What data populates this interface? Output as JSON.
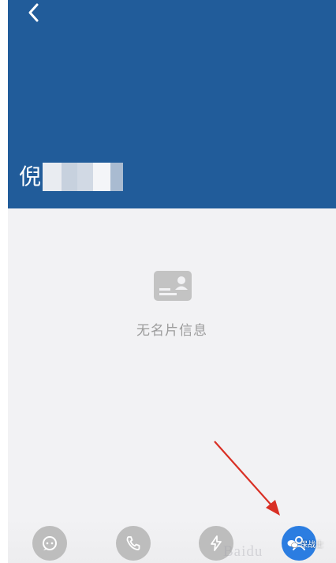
{
  "header": {
    "name_visible_char": "倪",
    "name_pixelation_colors": [
      "#e9ecf1",
      "#c7d1de",
      "#f4f5f8",
      "#d1d9e4",
      "#a9bbd1"
    ],
    "background_color": "#215c9a"
  },
  "back_icon": "chevron-left-icon",
  "empty_state": {
    "icon": "business-card-icon",
    "text": "无名片信息"
  },
  "bottom_actions": [
    {
      "icon": "message-icon",
      "color": "#bdbdbd"
    },
    {
      "icon": "phone-icon",
      "color": "#bdbdbd"
    },
    {
      "icon": "lightning-icon",
      "color": "#bdbdbd"
    },
    {
      "icon": "contact-icon",
      "color": "#2b7de1"
    }
  ],
  "annotation": {
    "arrow_color": "#d93025"
  },
  "watermark": {
    "brand": "Baidu",
    "source": "保战士"
  }
}
